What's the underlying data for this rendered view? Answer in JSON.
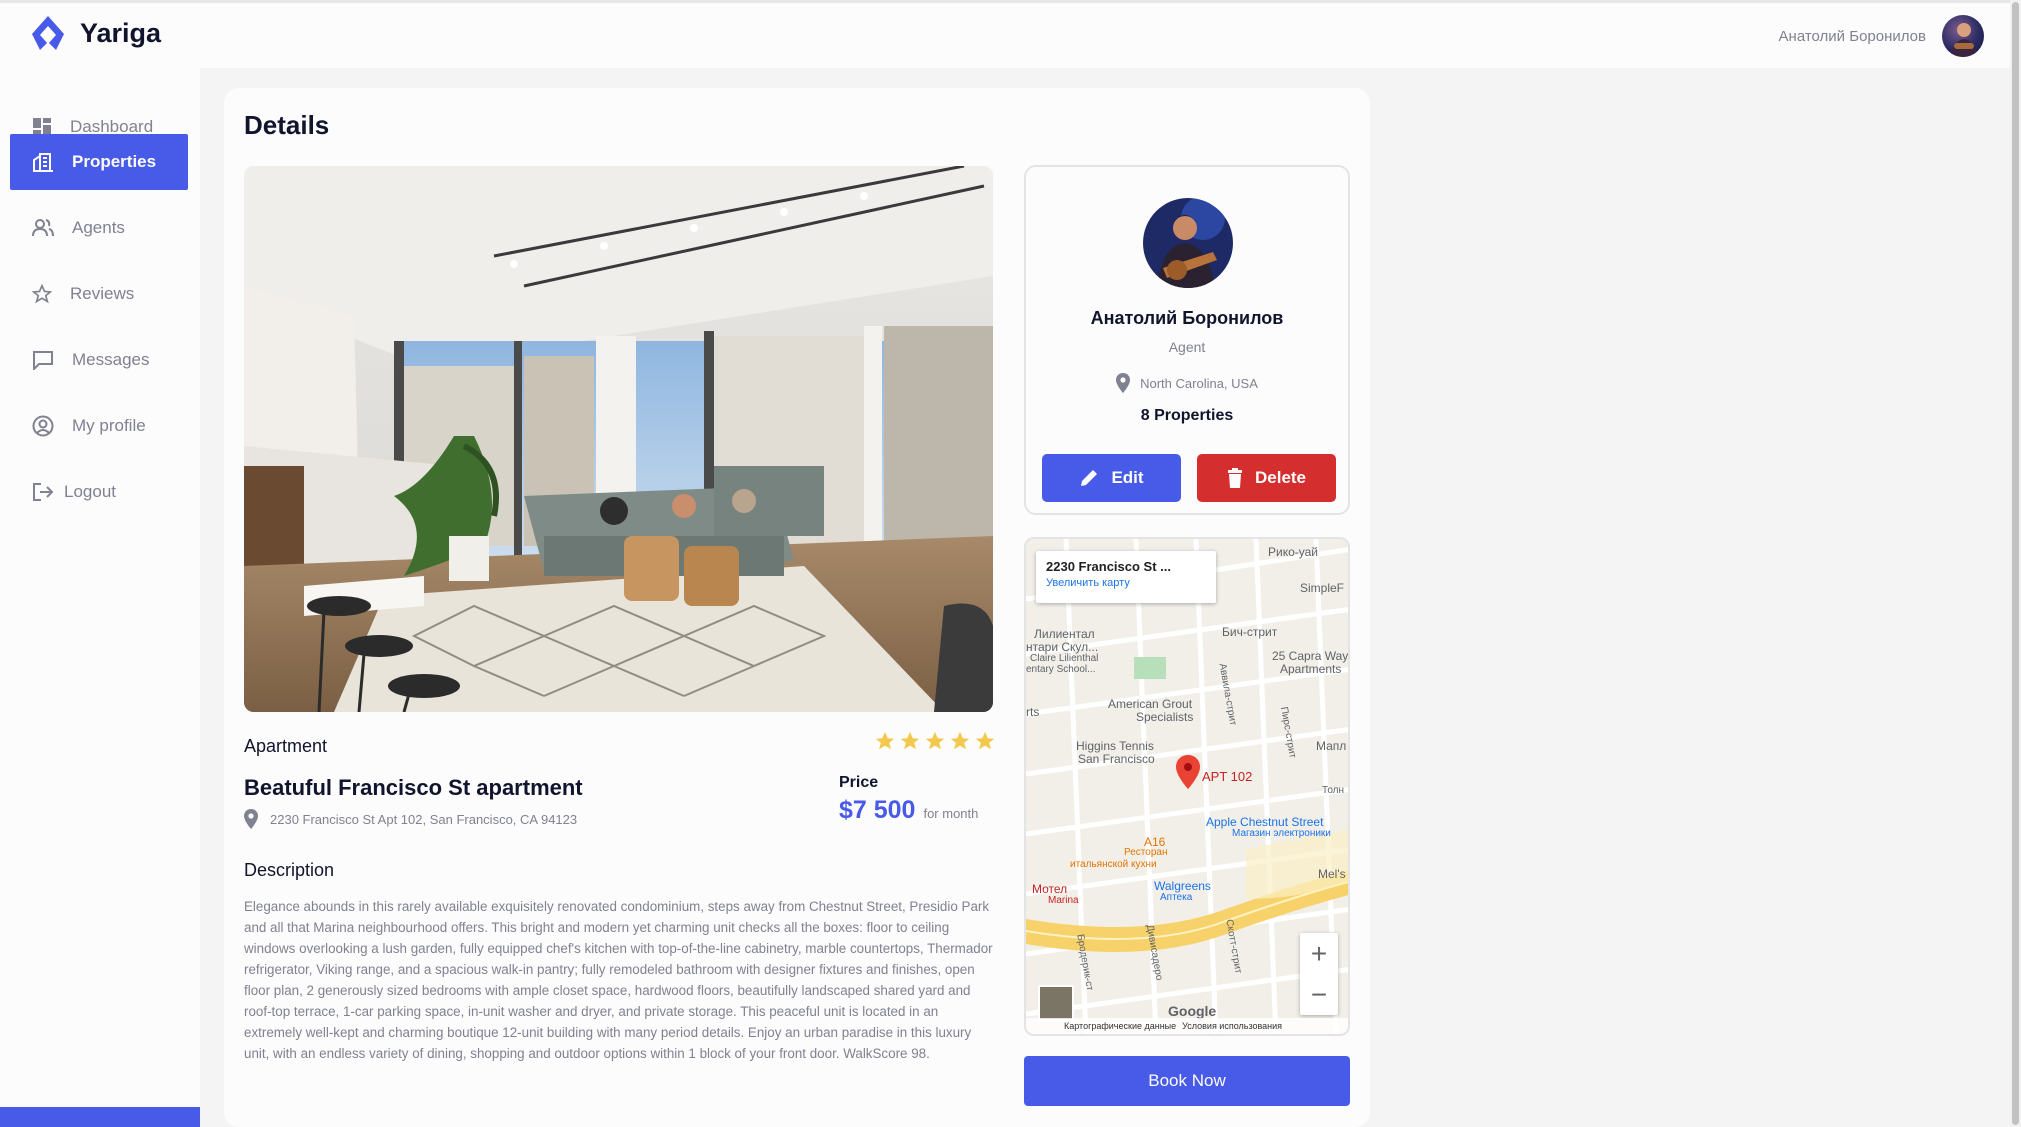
{
  "app": {
    "name": "Yariga"
  },
  "header": {
    "user_name": "Анатолий Боронилов"
  },
  "sidebar": {
    "items": [
      {
        "label": "Dashboard",
        "icon": "dashboard-icon"
      },
      {
        "label": "Properties",
        "icon": "properties-icon",
        "active": true
      },
      {
        "label": "Agents",
        "icon": "agents-icon"
      },
      {
        "label": "Reviews",
        "icon": "star-icon"
      },
      {
        "label": "Messages",
        "icon": "message-icon"
      },
      {
        "label": "My profile",
        "icon": "profile-icon"
      },
      {
        "label": "Logout",
        "icon": "logout-icon"
      }
    ]
  },
  "page": {
    "title": "Details"
  },
  "property": {
    "type": "Apartment",
    "rating": 5,
    "title": "Beatuful Francisco St apartment",
    "address": "2230 Francisco St Apt 102, San Francisco, CA 94123",
    "price_label": "Price",
    "price": "$7 500",
    "price_unit": "for month",
    "description_title": "Description",
    "description": "Elegance abounds in this rarely available exquisitely renovated condominium, steps away from Chestnut Street, Presidio Park and all that Marina neighbourhood offers. This bright and modern yet charming unit checks all the boxes: floor to ceiling windows overlooking a lush garden, fully equipped chef's kitchen with top-of-the-line cabinetry, marble countertops, Thermador refrigerator, Viking range, and a spacious walk-in pantry; fully remodeled bathroom with designer fixtures and finishes, open floor plan, 2 generously sized bedrooms with ample closet space, hardwood floors, beautifully landscaped shared yard and roof-top terrace, 1-car parking space, in-unit washer and dryer, and private storage. This peaceful unit is located in an extremely well-kept and charming boutique 12-unit building with many period details. Enjoy an urban paradise in this luxury unit, with an endless variety of dining, shopping and outdoor options within 1 block of your front door. WalkScore 98."
  },
  "agent": {
    "name": "Анатолий Боронилов",
    "role": "Agent",
    "location": "North Carolina, USA",
    "properties": "8 Properties",
    "edit_label": "Edit",
    "delete_label": "Delete"
  },
  "map": {
    "info_title": "2230 Francisco St ...",
    "info_link": "Увеличить карту",
    "marker_label": "APT 102",
    "places": [
      "Рико-уай",
      "SimpleF",
      "Бич-стрит",
      "Лилиентал",
      "нтари Скул...",
      "Claire Lilienthal",
      "entary School...",
      "25 Capra Way",
      "Apartments",
      "American Grout",
      "Specialists",
      "Higgins Tennis",
      "San Francisco",
      "Apple Chestnut Street",
      "Магазин электроники",
      "A16",
      "Ресторан",
      "итальянской кухни",
      "Мотел",
      "Marina",
      "Walgreens",
      "Аптека",
      "Mel's",
      "Бродерик-ст",
      "Дивисадеро",
      "Скотт-стрит",
      "Аввила-стрит",
      "Пирс-стрит",
      "Мапл",
      "Толн",
      "rts"
    ],
    "footer_data": "Картографические данные",
    "footer_terms": "Условия использования",
    "google": "Google"
  },
  "actions": {
    "book_label": "Book Now"
  },
  "colors": {
    "accent": "#475be8",
    "danger": "#d42e2e",
    "star": "#f2c94c",
    "muted": "#808191"
  }
}
